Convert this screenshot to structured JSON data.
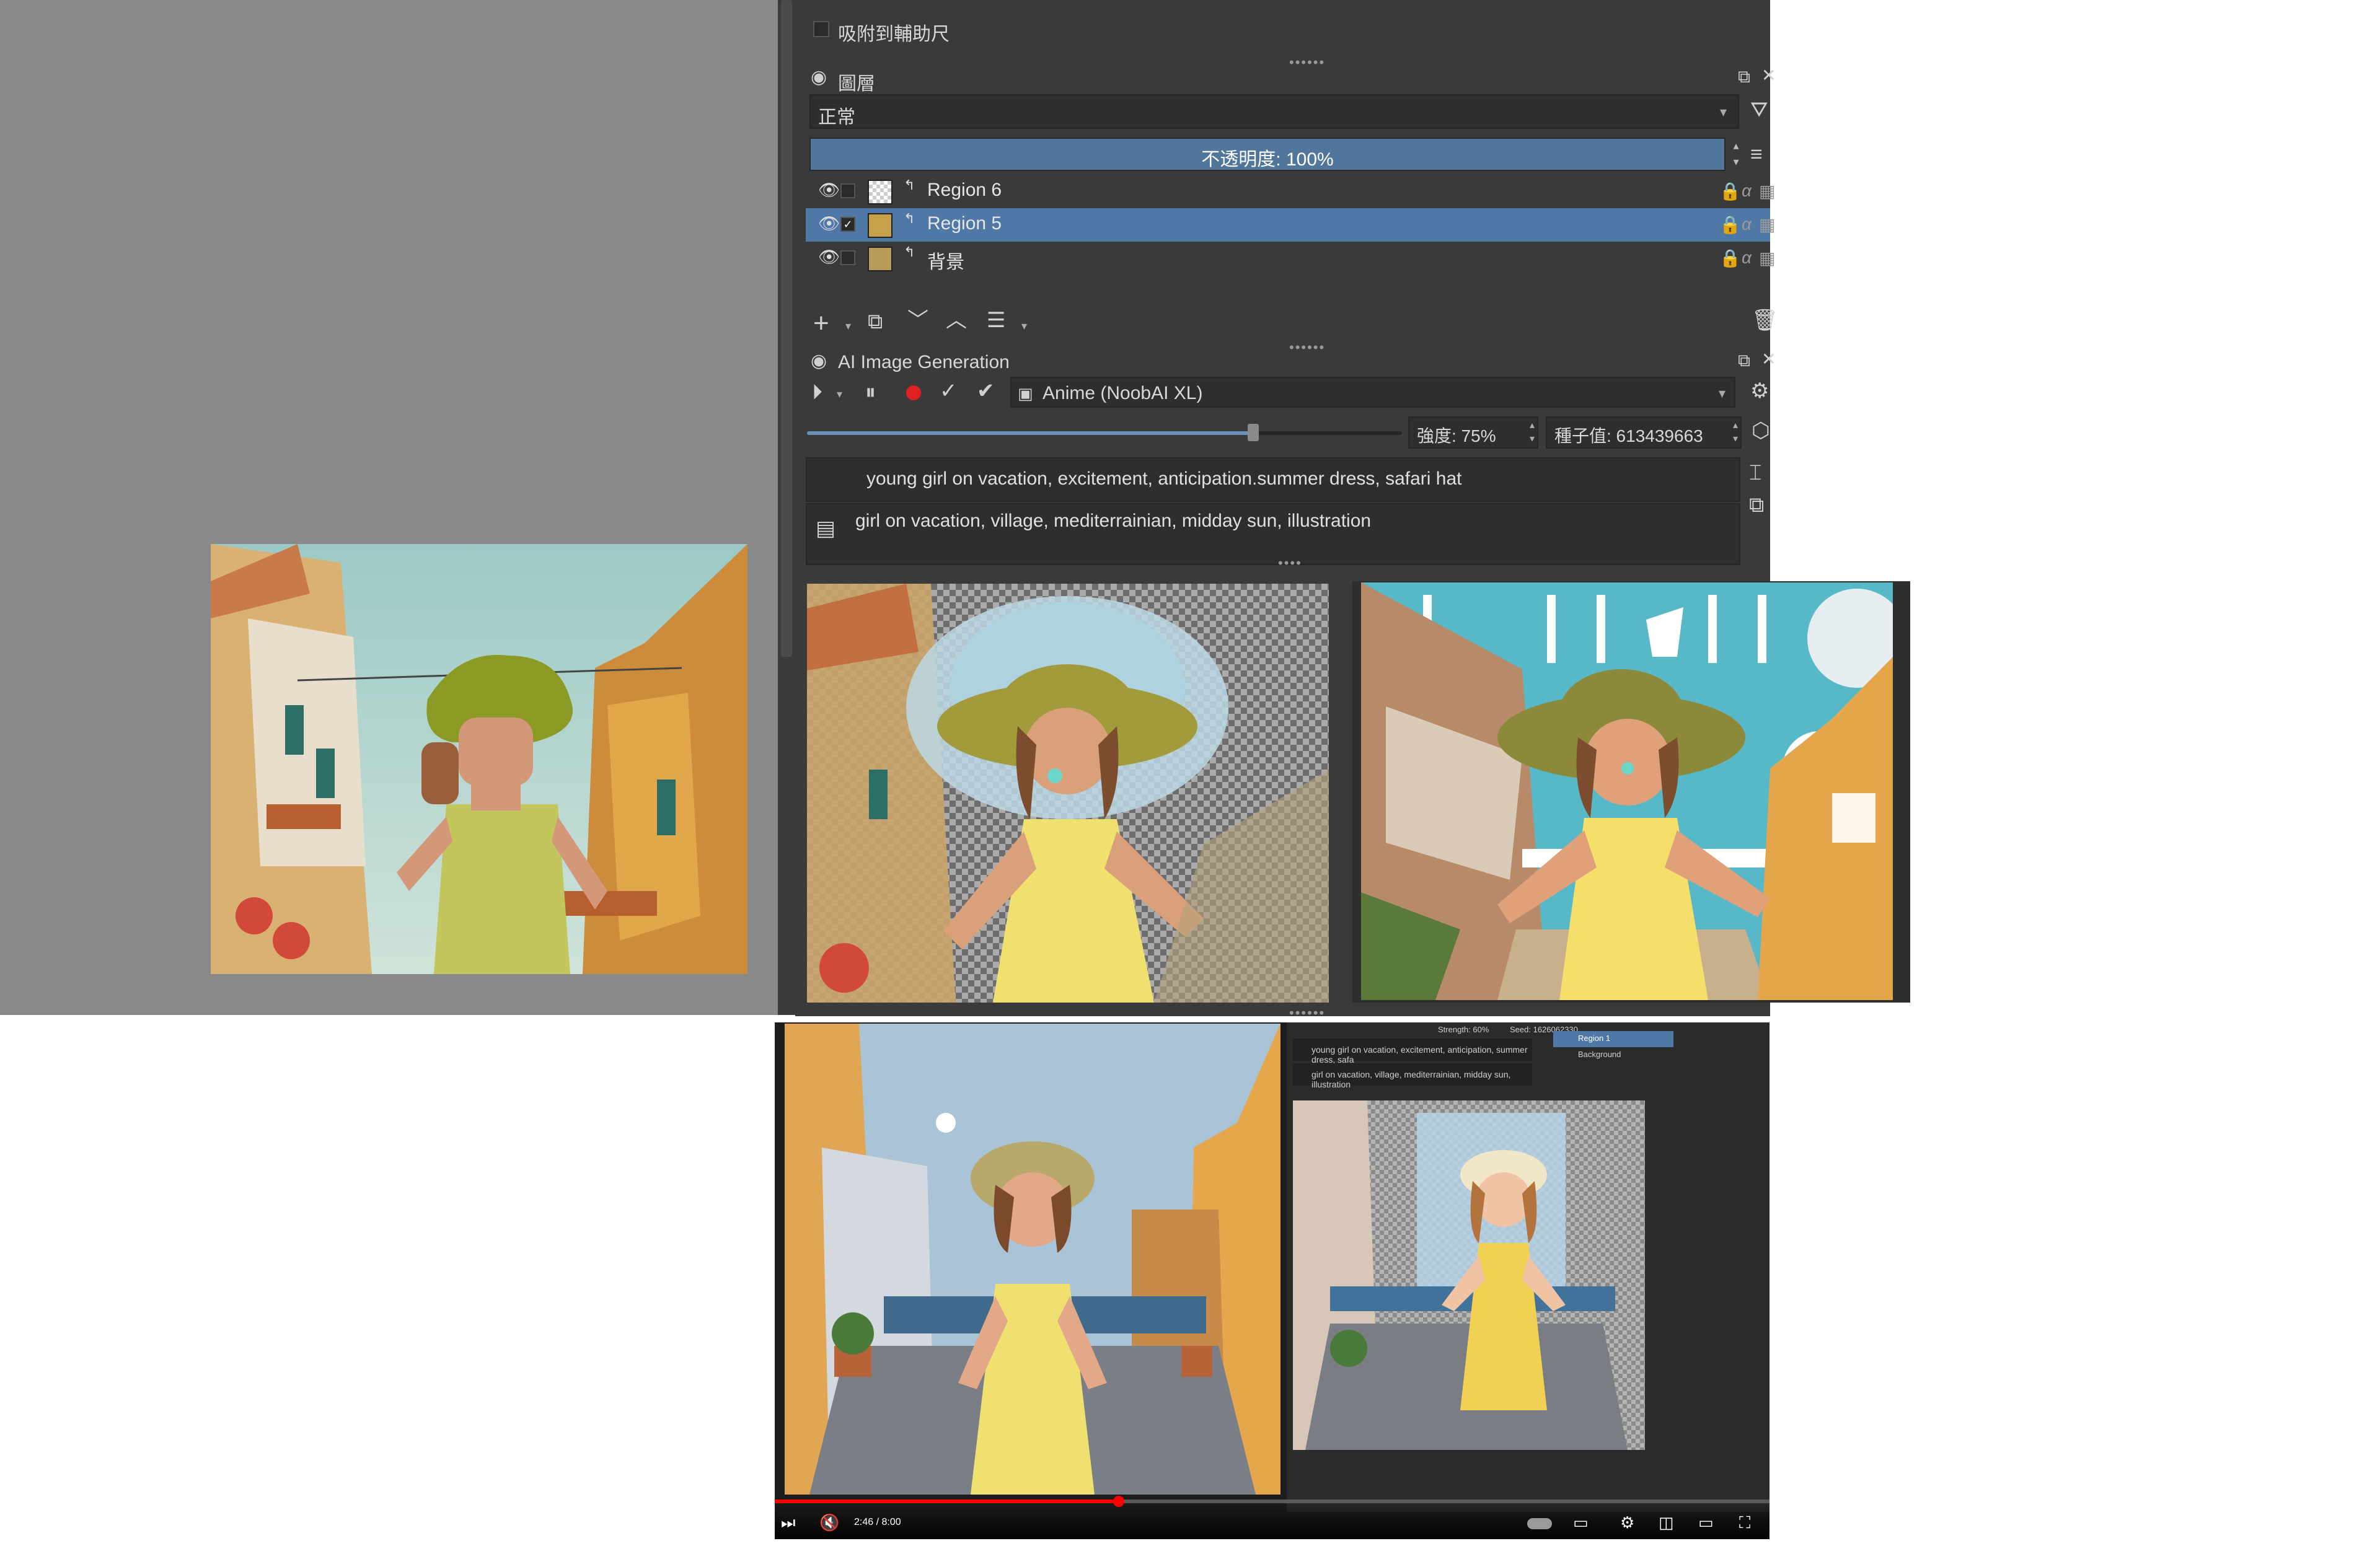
{
  "snap_checkbox": {
    "label": "吸附到輔助尺"
  },
  "layers_panel": {
    "title": "圖層",
    "blend_mode": "正常",
    "opacity_label": "不透明度: 100%",
    "layers": [
      {
        "name": "Region 6",
        "selected": false,
        "checked": false
      },
      {
        "name": "Region 5",
        "selected": true,
        "checked": true
      },
      {
        "name": "背景",
        "selected": false,
        "checked": false
      }
    ]
  },
  "ai_panel": {
    "title": "AI Image Generation",
    "model": "Anime (NoobAI XL)",
    "strength_label": "強度: 75%",
    "strength_value": 0.75,
    "seed_label": "種子值: 613439663",
    "positive_prompt": "young girl on vacation, excitement, anticipation.summer dress, safari hat",
    "negative_prompt": "girl on vacation, village, mediterrainian, midday sun, illustration"
  },
  "video": {
    "time": "2:46 / 8:00",
    "progress": 0.3458,
    "inner_prompt_positive": "young girl on vacation, excitement, anticipation, summer dress, safa",
    "inner_prompt_negative": "girl on vacation, village, mediterrainian, midday sun, illustration",
    "inner_strength": "Strength: 60%",
    "inner_seed": "Seed: 1626062330",
    "inner_layers": [
      "Region 1",
      "Background"
    ]
  },
  "colors": {
    "panel_bg": "#3a3a3a",
    "selection": "#4f78a6",
    "canvas_bg": "#8a8a8a",
    "video_progress": "#ff0000"
  }
}
